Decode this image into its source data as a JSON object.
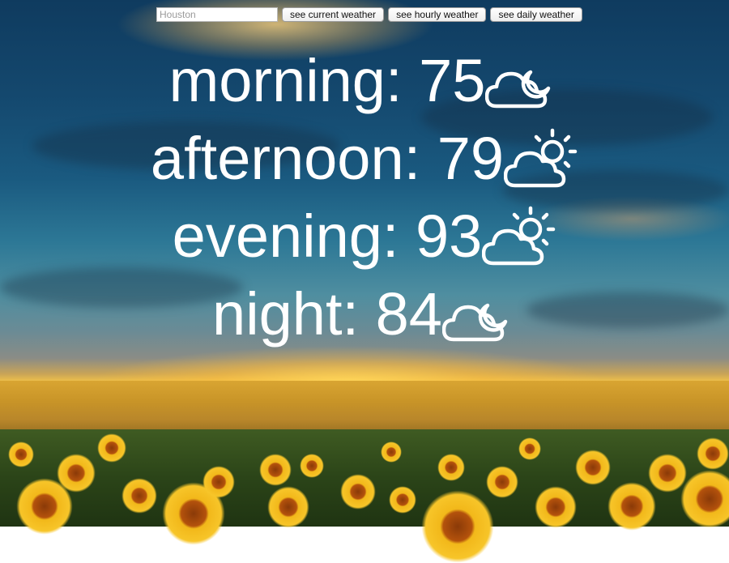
{
  "search": {
    "placeholder": "Houston"
  },
  "buttons": {
    "current": "see current weather",
    "hourly": "see hourly weather",
    "daily": "see daily weather"
  },
  "forecast": [
    {
      "period": "morning",
      "temperature": "75",
      "icon": "partly-cloudy-night-icon"
    },
    {
      "period": "afternoon",
      "temperature": "79",
      "icon": "partly-cloudy-day-icon"
    },
    {
      "period": "evening",
      "temperature": "93",
      "icon": "partly-cloudy-day-icon"
    },
    {
      "period": "night",
      "temperature": "84",
      "icon": "partly-cloudy-night-icon"
    }
  ]
}
